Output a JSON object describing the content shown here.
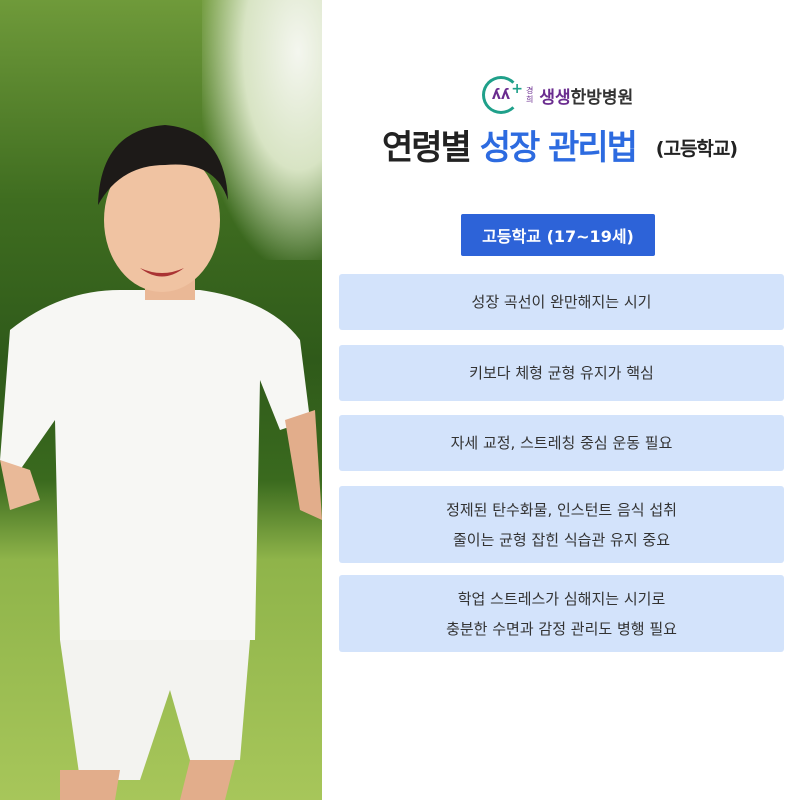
{
  "logo": {
    "small_top": "경",
    "small_bottom": "희",
    "name_accent": "생생",
    "name_rest": "한방병원"
  },
  "title": {
    "part1": "연령별",
    "part2": "성장 관리법",
    "suffix": "(고등학교)"
  },
  "badge": "고등학교 (17~19세)",
  "cards": [
    {
      "lines": [
        "성장 곡선이 완만해지는 시기"
      ]
    },
    {
      "lines": [
        "키보다 체형 균형 유지가 핵심"
      ]
    },
    {
      "lines": [
        "자세 교정, 스트레칭 중심 운동 필요"
      ]
    },
    {
      "lines": [
        "정제된 탄수화물, 인스턴트 음식 섭취",
        "줄이는 균형 잡힌 식습관 유지 중요"
      ]
    },
    {
      "lines": [
        "학업 스트레스가 심해지는 시기로",
        "충분한 수면과 감정 관리도 병행 필요"
      ]
    }
  ],
  "colors": {
    "accent": "#2d6be0",
    "badge": "#2d63d8",
    "card": "#d3e3fb",
    "brand_purple": "#6a2c8f",
    "brand_teal": "#1fa08a"
  }
}
